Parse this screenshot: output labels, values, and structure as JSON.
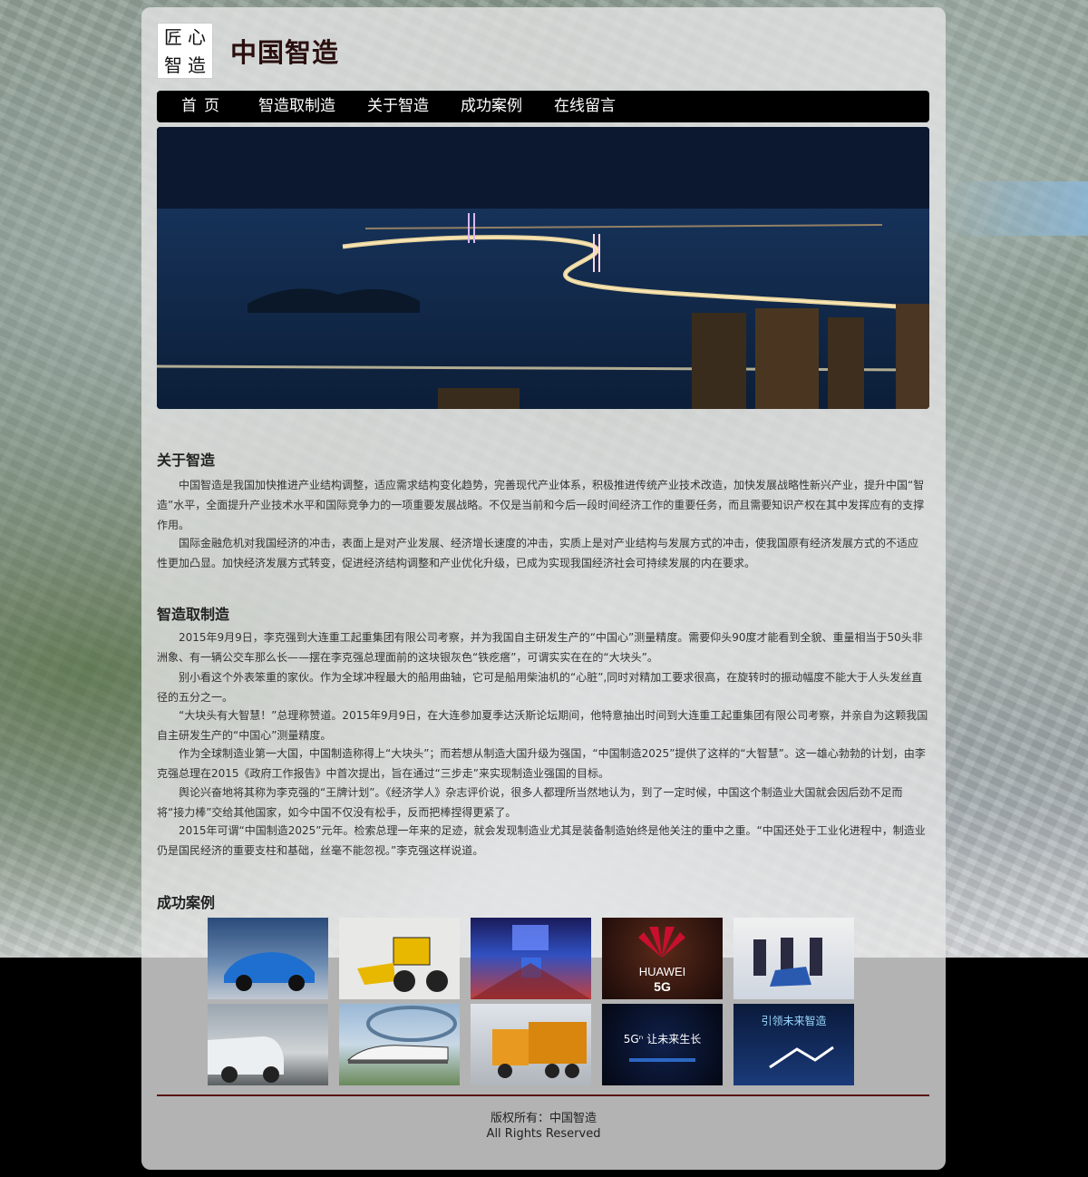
{
  "header": {
    "logo_chars": [
      "匠",
      "心",
      "智",
      "造"
    ],
    "title": "中国智造"
  },
  "nav": {
    "items": [
      "首页",
      "智造取制造",
      "关于智造",
      "成功案例",
      "在线留言"
    ]
  },
  "about": {
    "title": "关于智造",
    "paragraphs": [
      "中国智造是我国加快推进产业结构调整，适应需求结构变化趋势，完善现代产业体系，积极推进传统产业技术改造，加快发展战略性新兴产业，提升中国“智造”水平，全面提升产业技术水平和国际竞争力的一项重要发展战略。不仅是当前和今后一段时间经济工作的重要任务，而且需要知识产权在其中发挥应有的支撑作用。",
      "国际金融危机对我国经济的冲击，表面上是对产业发展、经济增长速度的冲击，实质上是对产业结构与发展方式的冲击，使我国原有经济发展方式的不适应性更加凸显。加快经济发展方式转变，促进经济结构调整和产业优化升级，已成为实现我国经济社会可持续发展的内在要求。"
    ]
  },
  "zhizao": {
    "title": "智造取制造",
    "paragraphs": [
      "2015年9月9日，李克强到大连重工起重集团有限公司考察，并为我国自主研发生产的“中国心”测量精度。需要仰头90度才能看到全貌、重量相当于50头非洲象、有一辆公交车那么长——摆在李克强总理面前的这块银灰色“铁疙瘩”，可谓实实在在的“大块头”。",
      "别小看这个外表笨重的家伙。作为全球冲程最大的船用曲轴，它可是船用柴油机的“心脏”,同时对精加工要求很高，在旋转时的振动幅度不能大于人头发丝直径的五分之一。",
      "“大块头有大智慧！”总理称赞道。2015年9月9日，在大连参加夏季达沃斯论坛期间，他特意抽出时间到大连重工起重集团有限公司考察，并亲自为这颗我国自主研发生产的“中国心”测量精度。",
      "作为全球制造业第一大国，中国制造称得上“大块头”；而若想从制造大国升级为强国，“中国制造2025”提供了这样的“大智慧”。这一雄心勃勃的计划，由李克强总理在2015《政府工作报告》中首次提出，旨在通过“三步走”来实现制造业强国的目标。",
      "舆论兴奋地将其称为李克强的“王牌计划”。《经济学人》杂志评价说，很多人都理所当然地认为，到了一定时候，中国这个制造业大国就会因后劲不足而将“接力棒”交给其他国家，如今中国不仅没有松手，反而把棒捏得更紧了。",
      "2015年可谓“中国制造2025”元年。检索总理一年来的足迹，就会发现制造业尤其是装备制造始终是他关注的重中之重。“中国还处于工业化进程中，制造业仍是国民经济的重要支柱和基础，丝毫不能忽视。”李克强这样说道。"
    ]
  },
  "cases": {
    "title": "成功案例",
    "thumbs": [
      {
        "kind": "car-show",
        "text": ""
      },
      {
        "kind": "loader",
        "text": ""
      },
      {
        "kind": "stage",
        "text": ""
      },
      {
        "kind": "huawei",
        "text": "HUAWEI",
        "sub": "5G"
      },
      {
        "kind": "press",
        "text": ""
      },
      {
        "kind": "parking",
        "text": ""
      },
      {
        "kind": "monorail",
        "text": ""
      },
      {
        "kind": "truck",
        "text": ""
      },
      {
        "kind": "5g-event",
        "text": "5Gⁿ 让未来生长"
      },
      {
        "kind": "smart-event",
        "text": "引领未来智造"
      }
    ]
  },
  "footer": {
    "copyright": "版权所有：中国智造",
    "rights": "All Rights Reserved"
  },
  "colors": {
    "nav_bg": "#000000",
    "title": "#2a0f0f",
    "divider": "#5a1010",
    "huawei_red": "#c8102e"
  }
}
